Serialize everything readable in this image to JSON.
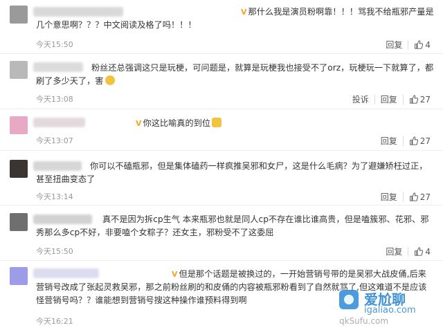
{
  "comments": [
    {
      "badge": "V",
      "text": "那什么我是演员粉啊靠！！！骂我不给瓶邪产量是几个意思啊？？？中文阅读及格了吗！！！",
      "time": "今天15:50",
      "reply": "回复",
      "likes": "4",
      "avatar_color": "#9a9a9a"
    },
    {
      "badge": "",
      "text": "粉丝还总强调这只是玩梗，可问题是，就算是玩梗我也接受不了orz，玩梗玩一下就算了，都刷了多少天了，害",
      "time": "今天13:08",
      "report": "投诉",
      "reply": "回复",
      "likes": "27",
      "avatar_color": "#b9b9b9"
    },
    {
      "badge": "V",
      "text": "你这比喻真的到位",
      "time": "今天13:07",
      "reply": "回复",
      "likes": "27",
      "avatar_color": "#e8a9c4"
    },
    {
      "badge": "",
      "text": "你可以不磕瓶邪，但是集体磕药一样疯推吴邪和女尸，这是什么毛病？为了避嫌矫枉过正，甚至扭曲变态了",
      "time": "今天13:14",
      "reply": "回复",
      "likes": "27",
      "avatar_color": "#3a3530"
    },
    {
      "badge": "",
      "text": "真不是因为拆cp生气 本来瓶邪也就是同人cp不存在谁比谁高贵，但是嗑簇邪、花邪、邪秀那么多cp不好，非要嗑个女粽子？还女主，邪粉受不了这委屈",
      "time": "今天15:50",
      "reply": "回复",
      "likes": "4",
      "avatar_color": "#6f6f6f"
    },
    {
      "badge": "V",
      "text": "但是那个话题是被换过的，一开始营销号带的是吴邪大战皮俑,后来营销号改成了张起灵救吴邪，那之前粉丝刷的和皮俑的内容被瓶邪粉看到了自然就骂了,但这难道不是应该怪营销号吗？？谁能想到营销号搜这种操作谁预料得到啊",
      "time": "今天16:21",
      "reply": "回复",
      "likes": "",
      "avatar_color": "#9d9ce6"
    }
  ],
  "watermark": {
    "brand": "爱尬聊",
    "domain": "igaliao.com",
    "sub": "qkSufu.com"
  },
  "colors": {
    "badge_gold": "#f5a623",
    "text": "#333333",
    "time": "#999999"
  }
}
